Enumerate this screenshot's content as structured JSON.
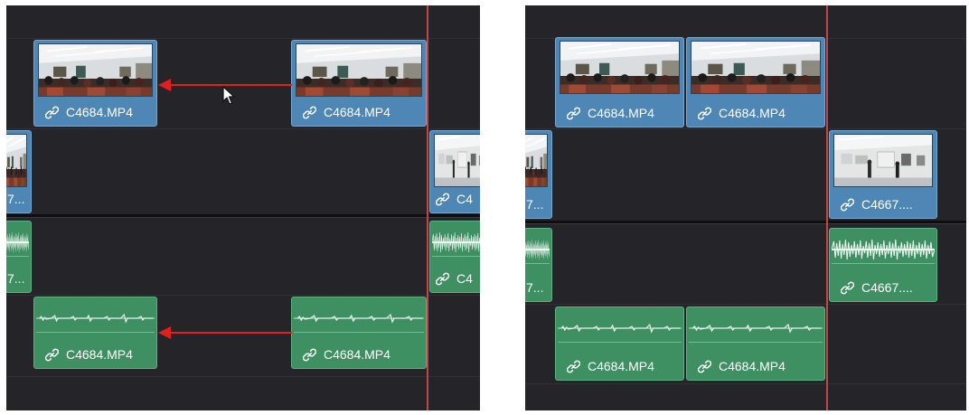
{
  "colors": {
    "timeline_bg": "#242429",
    "video_clip": "#4e86b6",
    "audio_clip": "#3e8f62",
    "playhead": "#c14646",
    "move_arrow": "#e02020"
  },
  "clip_icon": "link-icon",
  "before_panel": {
    "clips": {
      "v2_left": "C4684.MP4",
      "v2_right": "C4684.MP4",
      "v1_left": "7...",
      "v1_right": "C4",
      "a1_left": "7...",
      "a1_right": "C4",
      "a2_left": "C4684.MP4",
      "a2_right": "C4684.MP4"
    }
  },
  "after_panel": {
    "clips": {
      "v2_first": "C4684.MP4",
      "v2_second": "C4684.MP4",
      "v1_left": "7...",
      "v1_right": "C4667....",
      "a1_left": "7...",
      "a1_right": "C4667....",
      "a2_first": "C4684.MP4",
      "a2_second": "C4684.MP4"
    }
  }
}
